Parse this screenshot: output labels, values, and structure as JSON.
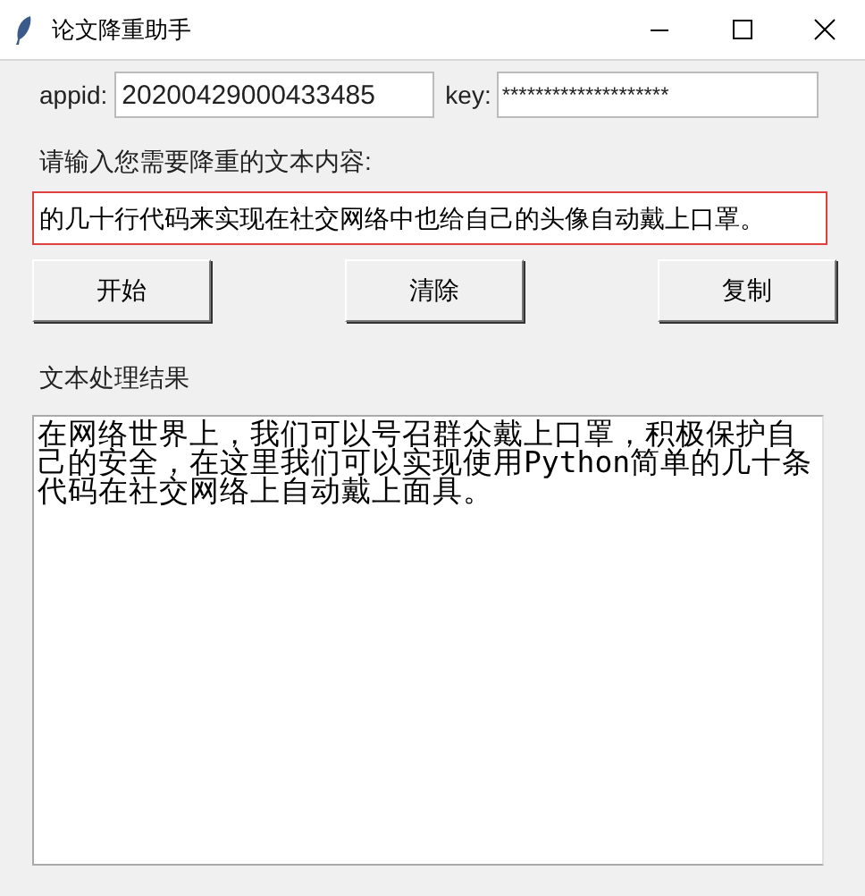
{
  "window": {
    "title": "论文降重助手"
  },
  "credentials": {
    "appid_label": "appid:",
    "appid_value": "20200429000433485",
    "key_label": "key:",
    "key_value": "********************"
  },
  "input": {
    "label": "请输入您需要降重的文本内容:",
    "value": "的几十行代码来实现在社交网络中也给自己的头像自动戴上口罩。"
  },
  "buttons": [
    "开始",
    "清除",
    "复制"
  ],
  "result": {
    "label": "文本处理结果",
    "value": "在网络世界上，我们可以号召群众戴上口罩，积极保护自己的安全，在这里我们可以实现使用Python简单的几十条代码在社交网络上自动戴上面具。"
  }
}
